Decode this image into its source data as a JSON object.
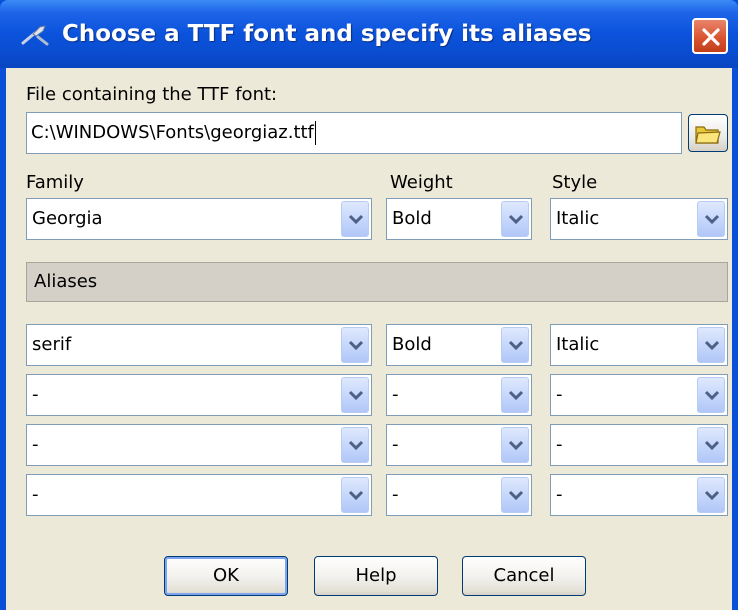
{
  "window": {
    "title": "Choose a TTF font and specify its aliases"
  },
  "file": {
    "label": "File containing the TTF font:",
    "value": "C:\\WINDOWS\\Fonts\\georgiaz.ttf"
  },
  "columns": {
    "family": "Family",
    "weight": "Weight",
    "style": "Style"
  },
  "font": {
    "family": "Georgia",
    "weight": "Bold",
    "style": "Italic"
  },
  "aliases_label": "Aliases",
  "aliases": [
    {
      "family": "serif",
      "weight": "Bold",
      "style": "Italic"
    },
    {
      "family": "-",
      "weight": "-",
      "style": "-"
    },
    {
      "family": "-",
      "weight": "-",
      "style": "-"
    },
    {
      "family": "-",
      "weight": "-",
      "style": "-"
    }
  ],
  "buttons": {
    "ok": "OK",
    "help": "Help",
    "cancel": "Cancel"
  },
  "icons": {
    "title": "tools-icon",
    "close": "close-icon",
    "browse": "folder-icon",
    "dropdown": "chevron-down-icon"
  },
  "colors": {
    "titlebar": "#0a4fd8",
    "dialog_bg": "#ece9d8",
    "close_button": "#d8512e",
    "combo_arrow": "#c2d4fb"
  }
}
